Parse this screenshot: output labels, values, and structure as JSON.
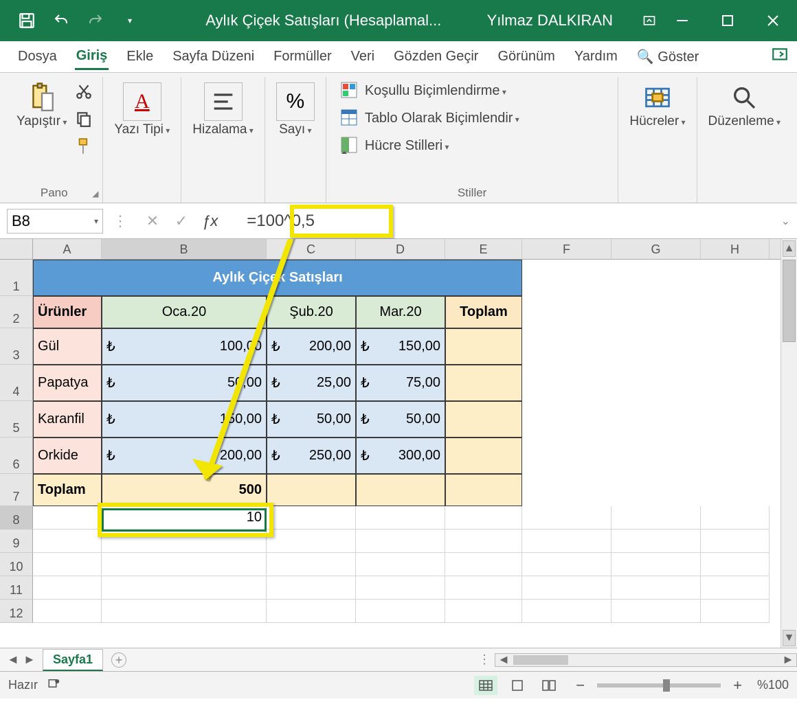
{
  "titlebar": {
    "doc_title": "Aylık Çiçek Satışları (Hesaplamal...",
    "user": "Yılmaz DALKIRAN"
  },
  "ribbon_tabs": {
    "file": "Dosya",
    "home": "Giriş",
    "insert": "Ekle",
    "layout": "Sayfa Düzeni",
    "formulas": "Formüller",
    "data": "Veri",
    "review": "Gözden Geçir",
    "view": "Görünüm",
    "help": "Yardım",
    "tell_me": "Göster"
  },
  "ribbon": {
    "paste": "Yapıştır",
    "clipboard_group": "Pano",
    "font": "Yazı Tipi",
    "alignment": "Hizalama",
    "number": "Sayı",
    "cond_fmt": "Koşullu Biçimlendirme",
    "table_fmt": "Tablo Olarak Biçimlendir",
    "cell_styles": "Hücre Stilleri",
    "styles_group": "Stiller",
    "cells": "Hücreler",
    "editing": "Düzenleme"
  },
  "formula_bar": {
    "namebox": "B8",
    "formula": "=100^0,5"
  },
  "sheet": {
    "columns": [
      "A",
      "B",
      "C",
      "D",
      "E",
      "F",
      "G",
      "H"
    ],
    "title": "Aylık Çiçek Satışları",
    "hdr_products": "Ürünler",
    "hdr_months": [
      "Oca.20",
      "Şub.20",
      "Mar.20"
    ],
    "hdr_total": "Toplam",
    "products": [
      "Gül",
      "Papatya",
      "Karanfil",
      "Orkide"
    ],
    "currency": "₺",
    "data": [
      [
        "100,00",
        "200,00",
        "150,00"
      ],
      [
        "50,00",
        "25,00",
        "75,00"
      ],
      [
        "150,00",
        "50,00",
        "50,00"
      ],
      [
        "200,00",
        "250,00",
        "300,00"
      ]
    ],
    "row_total_label": "Toplam",
    "b7": "500",
    "b8": "10"
  },
  "tabs": {
    "sheet1": "Sayfa1"
  },
  "status": {
    "ready": "Hazır",
    "zoom": "%100"
  },
  "chart_data": {
    "type": "table",
    "title": "Aylık Çiçek Satışları",
    "columns": [
      "Ürünler",
      "Oca.20",
      "Şub.20",
      "Mar.20",
      "Toplam"
    ],
    "rows": [
      [
        "Gül",
        100.0,
        200.0,
        150.0,
        null
      ],
      [
        "Papatya",
        50.0,
        25.0,
        75.0,
        null
      ],
      [
        "Karanfil",
        150.0,
        50.0,
        50.0,
        null
      ],
      [
        "Orkide",
        200.0,
        250.0,
        300.0,
        null
      ],
      [
        "Toplam",
        500,
        null,
        null,
        null
      ]
    ],
    "currency": "₺",
    "selected_cell_formula": "=100^0,5",
    "selected_cell_value": 10
  }
}
